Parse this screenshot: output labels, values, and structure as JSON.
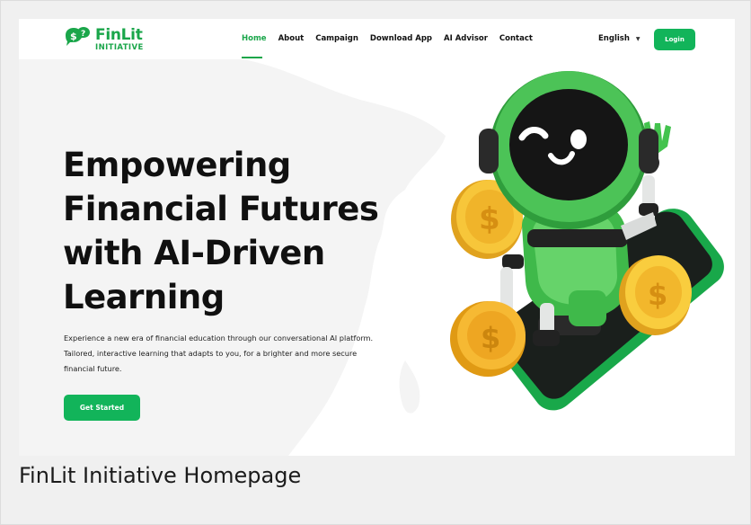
{
  "brand": {
    "name": "FinLit",
    "sub": "INITIATIVE",
    "logo_glyph": "$?",
    "accent_color": "#1aa64a",
    "button_color": "#12b45a"
  },
  "nav": {
    "items": [
      {
        "label": "Home",
        "active": true
      },
      {
        "label": "About",
        "active": false
      },
      {
        "label": "Campaign",
        "active": false
      },
      {
        "label": "Download App",
        "active": false
      },
      {
        "label": "AI Advisor",
        "active": false
      },
      {
        "label": "Contact",
        "active": false
      }
    ],
    "language": "English",
    "language_icon": "chevron-down-icon",
    "login_label": "Login"
  },
  "hero": {
    "title_lines": [
      "Empowering",
      "Financial Futures",
      "with AI-Driven",
      "Learning"
    ],
    "description_lines": [
      "Experience a new era of financial education through our conversational AI platform.",
      "Tailored, interactive learning that adapts to you, for a brighter and more secure",
      "financial future."
    ],
    "cta_label": "Get Started",
    "illustration": "robot-with-coins-and-phone"
  },
  "caption": "FinLit Initiative Homepage"
}
